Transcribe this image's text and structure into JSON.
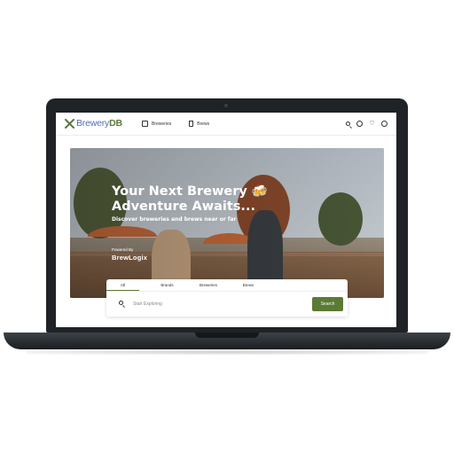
{
  "header": {
    "logo_text_a": "Brewery",
    "logo_text_b": "DB",
    "nav": [
      {
        "label": "Breweries",
        "icon": "building-icon"
      },
      {
        "label": "Brews",
        "icon": "beer-glass-icon"
      }
    ],
    "tools": [
      "search-icon",
      "location-icon",
      "heart-icon",
      "user-icon"
    ]
  },
  "hero": {
    "title_line1": "Your Next Brewery 🍻",
    "title_line2": "Adventure Awaits...",
    "subtitle": "Discover breweries and brews near or far",
    "powered_by": "Powered By",
    "brand": "BrewLogix"
  },
  "search": {
    "tabs": [
      {
        "label": "All",
        "active": true
      },
      {
        "label": "Brands",
        "active": false
      },
      {
        "label": "Breweries",
        "active": false
      },
      {
        "label": "Brews",
        "active": false
      }
    ],
    "placeholder": "Start Exploring",
    "button_label": "Search"
  },
  "colors": {
    "accent": "#5a7a35",
    "logo_blue": "#4e6fb3",
    "laptop": "#1f2226"
  }
}
